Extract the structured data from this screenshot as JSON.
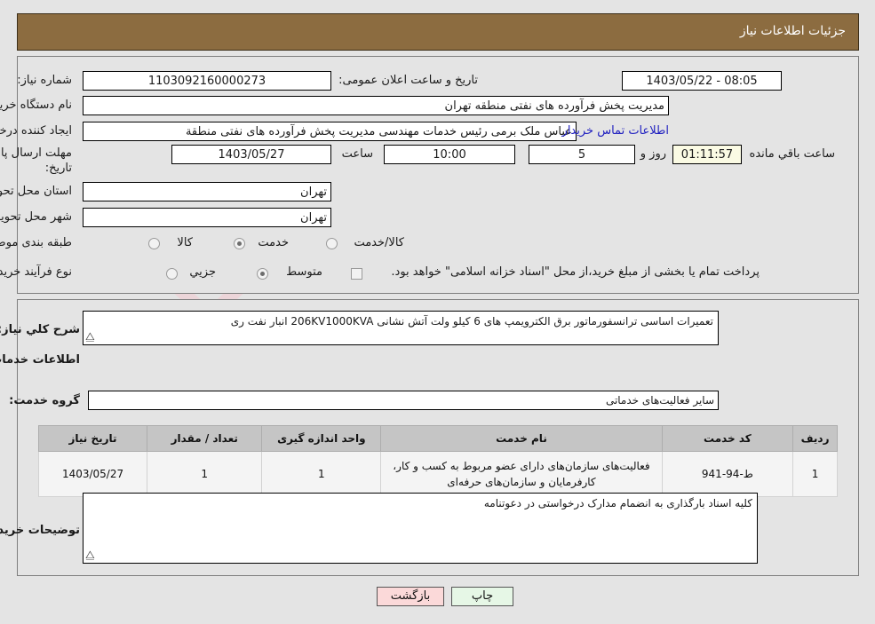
{
  "header": {
    "title": "جزئیات اطلاعات نیاز"
  },
  "top_form": {
    "need_number_label": "شماره نیاز:",
    "need_number_value": "1103092160000273",
    "announce_label": "تاریخ و ساعت اعلان عمومی:",
    "announce_value": "08:05 - 1403/05/22",
    "buyer_org_label": "نام دستگاه خریدار:",
    "buyer_org_value": "مدیریت پخش فرآورده های نفتی منطقه تهران",
    "creator_label": "ایجاد کننده درخواست:",
    "creator_value": "عباس ملک برمی رئیس خدمات مهندسی مدیریت پخش فرآورده های نفتی منطقة",
    "contact_link": "اطلاعات تماس خریدار",
    "deadline_label": "مهلت ارسال پاسخ: تا تاریخ:",
    "deadline_date": "1403/05/27",
    "hour_label": "ساعت",
    "deadline_time": "10:00",
    "days_value": "5",
    "days_label": "روز و",
    "countdown_value": "01:11:57",
    "remaining_label": "ساعت باقي مانده",
    "province_label": "استان محل تحویل:",
    "province_value": "تهران",
    "city_label": "شهر محل تحویل:",
    "city_value": "تهران",
    "category_label": "طبقه بندی موضوعی:",
    "category_options": [
      "کالا",
      "خدمت",
      "کالا/خدمت"
    ],
    "category_selected": "خدمت",
    "process_label": "نوع فرآیند خرید :",
    "process_options": [
      "جزیي",
      "متوسط"
    ],
    "process_selected": "متوسط",
    "treasury_checkbox_text": "پرداخت تمام یا بخشی از مبلغ خرید،از محل \"اسناد خزانه اسلامی\" خواهد بود."
  },
  "description": {
    "label": "شرح کلي نیاز:",
    "value": "تعمیرات اساسی ترانسفورماتور برق الکترویمپ های 6 کیلو ولت آتش نشانی 206KV1000KVA انبار نفت ری"
  },
  "services": {
    "section_title": "اطلاعات خدمات مورد نیاز",
    "group_label": "گروه خدمت:",
    "group_value": "سایر فعالیت‌های خدماتی",
    "table": {
      "headers": [
        "ردیف",
        "کد خدمت",
        "نام خدمت",
        "واحد اندازه گیری",
        "تعداد / مقدار",
        "تاریخ نیاز"
      ],
      "rows": [
        {
          "row": "1",
          "code": "ط-94-941",
          "name": "فعالیت‌های سازمان‌های دارای عضو مربوط به کسب و کار، کارفرمایان و سازمان‌های حرفه‌ای",
          "unit": "1",
          "quantity": "1",
          "need_date": "1403/05/27"
        }
      ]
    }
  },
  "buyer_notes": {
    "label": "توضیحات خریدار:",
    "value": "کلیه اسناد بارگذاری به انضمام مدارک درخواستی در دعوتنامه"
  },
  "footer": {
    "print_label": "چاپ",
    "back_label": "بازگشت"
  },
  "watermark": {
    "text_left": "Irani",
    "text_right": "Tender.net"
  },
  "colors": {
    "header_bar": "#8c6c40",
    "page_background": "#e4e4e4",
    "link": "#2020c0",
    "timer_background": "#fbfbe4",
    "print_button": "#e6f7e6",
    "back_button": "#fbd9d9"
  }
}
